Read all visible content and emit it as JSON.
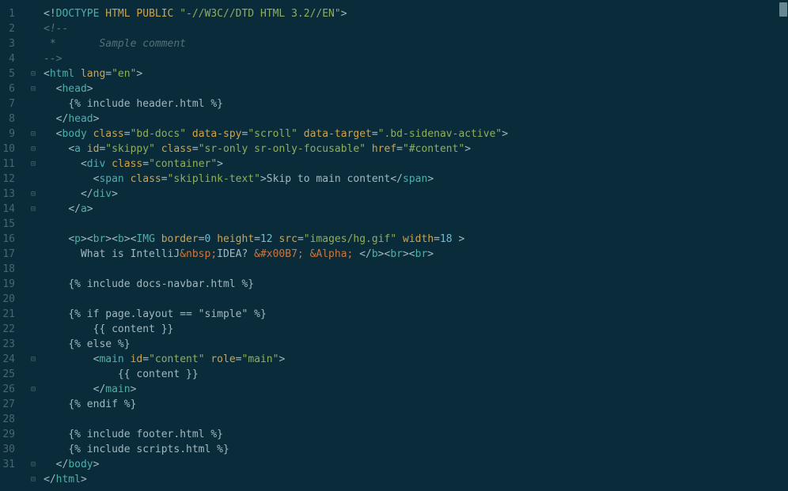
{
  "editor": {
    "lineNumbers": [
      "1",
      "2",
      "3",
      "4",
      "5",
      "6",
      "7",
      "8",
      "9",
      "10",
      "11",
      "12",
      "13",
      "14",
      "15",
      "16",
      "17",
      "18",
      "19",
      "20",
      "21",
      "22",
      "23",
      "24",
      "25",
      "26",
      "27",
      "28",
      "29",
      "30",
      "31",
      ""
    ],
    "fold": [
      "",
      "",
      "",
      "",
      "⊟",
      "⊟",
      "",
      "",
      "⊟",
      "⊟",
      "⊟",
      "",
      "⊟",
      "⊟",
      "",
      "",
      "",
      "",
      "",
      "",
      "",
      "",
      "",
      "⊟",
      "",
      "⊟",
      "",
      "",
      "",
      "",
      "⊟",
      "⊟"
    ],
    "lines": [
      [
        {
          "t": "<!",
          "c": "punct"
        },
        {
          "t": "DOCTYPE ",
          "c": "tag"
        },
        {
          "t": "HTML PUBLIC ",
          "c": "attr"
        },
        {
          "t": "\"-//W3C//DTD HTML 3.2//EN\"",
          "c": "str"
        },
        {
          "t": ">",
          "c": "punct"
        }
      ],
      [
        {
          "t": "<!--",
          "c": "comment"
        }
      ],
      [
        {
          "t": " *       Sample comment",
          "c": "comment"
        }
      ],
      [
        {
          "t": "-->",
          "c": "comment"
        }
      ],
      [
        {
          "t": "<",
          "c": "punct"
        },
        {
          "t": "html ",
          "c": "tag"
        },
        {
          "t": "lang",
          "c": "attr"
        },
        {
          "t": "=",
          "c": "punct"
        },
        {
          "t": "\"en\"",
          "c": "str"
        },
        {
          "t": ">",
          "c": "punct"
        }
      ],
      [
        {
          "t": "  ",
          "c": "txt"
        },
        {
          "t": "<",
          "c": "punct"
        },
        {
          "t": "head",
          "c": "tag"
        },
        {
          "t": ">",
          "c": "punct"
        }
      ],
      [
        {
          "t": "    ",
          "c": "txt"
        },
        {
          "t": "{% include header.html %}",
          "c": "template"
        }
      ],
      [
        {
          "t": "  ",
          "c": "txt"
        },
        {
          "t": "</",
          "c": "punct"
        },
        {
          "t": "head",
          "c": "tag"
        },
        {
          "t": ">",
          "c": "punct"
        }
      ],
      [
        {
          "t": "  ",
          "c": "txt"
        },
        {
          "t": "<",
          "c": "punct"
        },
        {
          "t": "body ",
          "c": "tag"
        },
        {
          "t": "class",
          "c": "attr"
        },
        {
          "t": "=",
          "c": "punct"
        },
        {
          "t": "\"bd-docs\"",
          "c": "str"
        },
        {
          "t": " ",
          "c": "txt"
        },
        {
          "t": "data-spy",
          "c": "attr"
        },
        {
          "t": "=",
          "c": "punct"
        },
        {
          "t": "\"scroll\"",
          "c": "str"
        },
        {
          "t": " ",
          "c": "txt"
        },
        {
          "t": "data-target",
          "c": "attr"
        },
        {
          "t": "=",
          "c": "punct"
        },
        {
          "t": "\".bd-sidenav-active\"",
          "c": "str"
        },
        {
          "t": ">",
          "c": "punct"
        }
      ],
      [
        {
          "t": "    ",
          "c": "txt"
        },
        {
          "t": "<",
          "c": "punct"
        },
        {
          "t": "a ",
          "c": "tag"
        },
        {
          "t": "id",
          "c": "attr"
        },
        {
          "t": "=",
          "c": "punct"
        },
        {
          "t": "\"skippy\"",
          "c": "str"
        },
        {
          "t": " ",
          "c": "txt"
        },
        {
          "t": "class",
          "c": "attr"
        },
        {
          "t": "=",
          "c": "punct"
        },
        {
          "t": "\"sr-only sr-only-focusable\"",
          "c": "str"
        },
        {
          "t": " ",
          "c": "txt"
        },
        {
          "t": "href",
          "c": "attr"
        },
        {
          "t": "=",
          "c": "punct"
        },
        {
          "t": "\"#content\"",
          "c": "str"
        },
        {
          "t": ">",
          "c": "punct"
        }
      ],
      [
        {
          "t": "      ",
          "c": "txt"
        },
        {
          "t": "<",
          "c": "punct"
        },
        {
          "t": "div ",
          "c": "tag"
        },
        {
          "t": "class",
          "c": "attr"
        },
        {
          "t": "=",
          "c": "punct"
        },
        {
          "t": "\"container\"",
          "c": "str"
        },
        {
          "t": ">",
          "c": "punct"
        }
      ],
      [
        {
          "t": "        ",
          "c": "txt"
        },
        {
          "t": "<",
          "c": "punct"
        },
        {
          "t": "span ",
          "c": "tag"
        },
        {
          "t": "class",
          "c": "attr"
        },
        {
          "t": "=",
          "c": "punct"
        },
        {
          "t": "\"skiplink-text\"",
          "c": "str"
        },
        {
          "t": ">",
          "c": "punct"
        },
        {
          "t": "Skip to main content",
          "c": "txt"
        },
        {
          "t": "</",
          "c": "punct"
        },
        {
          "t": "span",
          "c": "tag"
        },
        {
          "t": ">",
          "c": "punct"
        }
      ],
      [
        {
          "t": "      ",
          "c": "txt"
        },
        {
          "t": "</",
          "c": "punct"
        },
        {
          "t": "div",
          "c": "tag"
        },
        {
          "t": ">",
          "c": "punct"
        }
      ],
      [
        {
          "t": "    ",
          "c": "txt"
        },
        {
          "t": "</",
          "c": "punct"
        },
        {
          "t": "a",
          "c": "tag"
        },
        {
          "t": ">",
          "c": "punct"
        }
      ],
      [
        {
          "t": " ",
          "c": "txt"
        }
      ],
      [
        {
          "t": "    ",
          "c": "txt"
        },
        {
          "t": "<",
          "c": "punct"
        },
        {
          "t": "p",
          "c": "tag"
        },
        {
          "t": "><",
          "c": "punct"
        },
        {
          "t": "br",
          "c": "tag"
        },
        {
          "t": "><",
          "c": "punct"
        },
        {
          "t": "b",
          "c": "tag"
        },
        {
          "t": "><",
          "c": "punct"
        },
        {
          "t": "IMG ",
          "c": "tag"
        },
        {
          "t": "border",
          "c": "attr"
        },
        {
          "t": "=",
          "c": "punct"
        },
        {
          "t": "0 ",
          "c": "num"
        },
        {
          "t": "height",
          "c": "attr"
        },
        {
          "t": "=",
          "c": "punct"
        },
        {
          "t": "12 ",
          "c": "num"
        },
        {
          "t": "src",
          "c": "attr"
        },
        {
          "t": "=",
          "c": "punct"
        },
        {
          "t": "\"images/hg.gif\"",
          "c": "str"
        },
        {
          "t": " ",
          "c": "txt"
        },
        {
          "t": "width",
          "c": "attr"
        },
        {
          "t": "=",
          "c": "punct"
        },
        {
          "t": "18 ",
          "c": "num"
        },
        {
          "t": ">",
          "c": "punct"
        }
      ],
      [
        {
          "t": "      What is IntelliJ",
          "c": "txt"
        },
        {
          "t": "&nbsp;",
          "c": "entity"
        },
        {
          "t": "IDEA? ",
          "c": "txt"
        },
        {
          "t": "&#x00B7; &Alpha;",
          "c": "entity"
        },
        {
          "t": " ",
          "c": "txt"
        },
        {
          "t": "</",
          "c": "punct"
        },
        {
          "t": "b",
          "c": "tag"
        },
        {
          "t": "><",
          "c": "punct"
        },
        {
          "t": "br",
          "c": "tag"
        },
        {
          "t": "><",
          "c": "punct"
        },
        {
          "t": "br",
          "c": "tag"
        },
        {
          "t": ">",
          "c": "punct"
        }
      ],
      [
        {
          "t": " ",
          "c": "txt"
        }
      ],
      [
        {
          "t": "    ",
          "c": "txt"
        },
        {
          "t": "{% include docs-navbar.html %}",
          "c": "template"
        }
      ],
      [
        {
          "t": " ",
          "c": "txt"
        }
      ],
      [
        {
          "t": "    ",
          "c": "txt"
        },
        {
          "t": "{% if page.layout == \"simple\" %}",
          "c": "template"
        }
      ],
      [
        {
          "t": "        ",
          "c": "txt"
        },
        {
          "t": "{{ content }}",
          "c": "template"
        }
      ],
      [
        {
          "t": "    ",
          "c": "txt"
        },
        {
          "t": "{% else %}",
          "c": "template"
        }
      ],
      [
        {
          "t": "        ",
          "c": "txt"
        },
        {
          "t": "<",
          "c": "punct"
        },
        {
          "t": "main ",
          "c": "tag"
        },
        {
          "t": "id",
          "c": "attr"
        },
        {
          "t": "=",
          "c": "punct"
        },
        {
          "t": "\"content\"",
          "c": "str"
        },
        {
          "t": " ",
          "c": "txt"
        },
        {
          "t": "role",
          "c": "attr"
        },
        {
          "t": "=",
          "c": "punct"
        },
        {
          "t": "\"main\"",
          "c": "str"
        },
        {
          "t": ">",
          "c": "punct"
        }
      ],
      [
        {
          "t": "            ",
          "c": "txt"
        },
        {
          "t": "{{ content }}",
          "c": "template"
        }
      ],
      [
        {
          "t": "        ",
          "c": "txt"
        },
        {
          "t": "</",
          "c": "punct"
        },
        {
          "t": "main",
          "c": "tag"
        },
        {
          "t": ">",
          "c": "punct"
        }
      ],
      [
        {
          "t": "    ",
          "c": "txt"
        },
        {
          "t": "{% endif %}",
          "c": "template"
        }
      ],
      [
        {
          "t": " ",
          "c": "txt"
        }
      ],
      [
        {
          "t": "    ",
          "c": "txt"
        },
        {
          "t": "{% include footer.html %}",
          "c": "template"
        }
      ],
      [
        {
          "t": "    ",
          "c": "txt"
        },
        {
          "t": "{% include scripts.html %}",
          "c": "template"
        }
      ],
      [
        {
          "t": "  ",
          "c": "txt"
        },
        {
          "t": "</",
          "c": "punct"
        },
        {
          "t": "body",
          "c": "tag"
        },
        {
          "t": ">",
          "c": "punct"
        }
      ],
      [
        {
          "t": "</",
          "c": "punct"
        },
        {
          "t": "html",
          "c": "tag"
        },
        {
          "t": ">",
          "c": "punct"
        }
      ]
    ]
  }
}
